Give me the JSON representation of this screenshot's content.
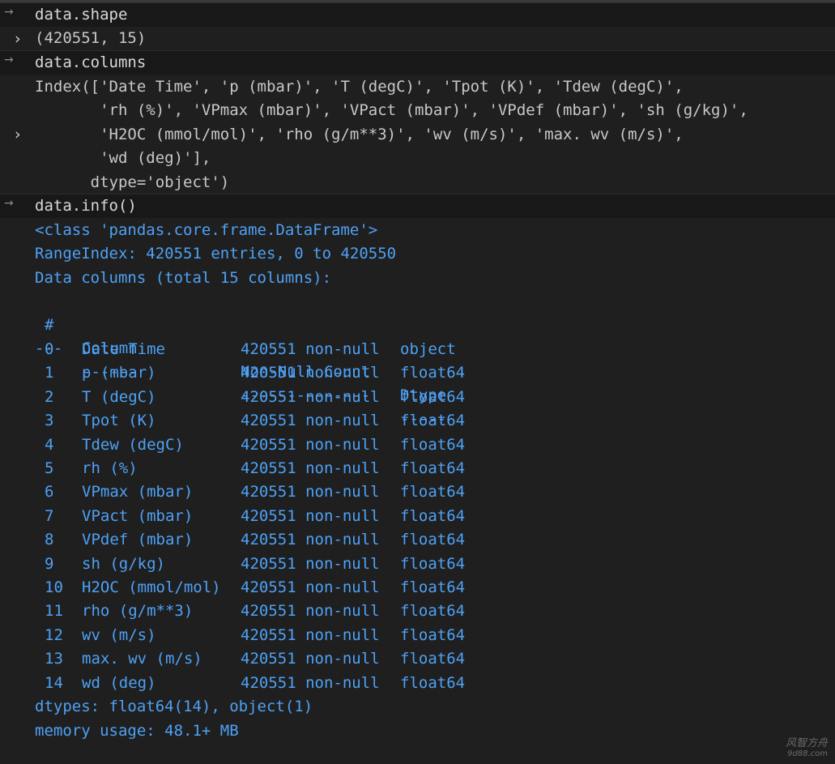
{
  "cells": [
    {
      "input": "data.shape",
      "output": "(420551, 15)"
    },
    {
      "input": "data.columns",
      "output_lines": [
        "Index(['Date Time', 'p (mbar)', 'T (degC)', 'Tpot (K)', 'Tdew (degC)',",
        "       'rh (%)', 'VPmax (mbar)', 'VPact (mbar)', 'VPdef (mbar)', 'sh (g/kg)',",
        "       'H2OC (mmol/mol)', 'rho (g/m**3)', 'wv (m/s)', 'max. wv (m/s)',",
        "       'wd (deg)'],",
        "      dtype='object')"
      ]
    },
    {
      "input": "data.info()"
    }
  ],
  "info": {
    "class_line": "<class 'pandas.core.frame.DataFrame'>",
    "range_index": "RangeIndex: 420551 entries, 0 to 420550",
    "columns_header": "Data columns (total 15 columns):",
    "headers": [
      "#",
      "Column",
      "Non-Null Count",
      "Dtype"
    ],
    "separators": [
      "---",
      "------",
      "--------------",
      "-----"
    ],
    "rows": [
      [
        "0",
        "Date Time",
        "420551 non-null",
        "object"
      ],
      [
        "1",
        "p (mbar)",
        "420551 non-null",
        "float64"
      ],
      [
        "2",
        "T (degC)",
        "420551 non-null",
        "float64"
      ],
      [
        "3",
        "Tpot (K)",
        "420551 non-null",
        "float64"
      ],
      [
        "4",
        "Tdew (degC)",
        "420551 non-null",
        "float64"
      ],
      [
        "5",
        "rh (%)",
        "420551 non-null",
        "float64"
      ],
      [
        "6",
        "VPmax (mbar)",
        "420551 non-null",
        "float64"
      ],
      [
        "7",
        "VPact (mbar)",
        "420551 non-null",
        "float64"
      ],
      [
        "8",
        "VPdef (mbar)",
        "420551 non-null",
        "float64"
      ],
      [
        "9",
        "sh (g/kg)",
        "420551 non-null",
        "float64"
      ],
      [
        "10",
        "H2OC (mmol/mol)",
        "420551 non-null",
        "float64"
      ],
      [
        "11",
        "rho (g/m**3)",
        "420551 non-null",
        "float64"
      ],
      [
        "12",
        "wv (m/s)",
        "420551 non-null",
        "float64"
      ],
      [
        "13",
        "max. wv (m/s)",
        "420551 non-null",
        "float64"
      ],
      [
        "14",
        "wd (deg)",
        "420551 non-null",
        "float64"
      ]
    ],
    "dtypes_line": "dtypes: float64(14), object(1)",
    "memory_line": "memory usage: 48.1+ MB"
  },
  "icons": {
    "run_arrow": "→",
    "expand_chevron": "›"
  },
  "watermark": {
    "line1": "风智方舟",
    "line2": "9d88.com"
  },
  "colors": {
    "background": "#1f1f1f",
    "input_row": "#181818",
    "info_text": "#4ea1f5",
    "code_text": "#d8d8d8"
  }
}
